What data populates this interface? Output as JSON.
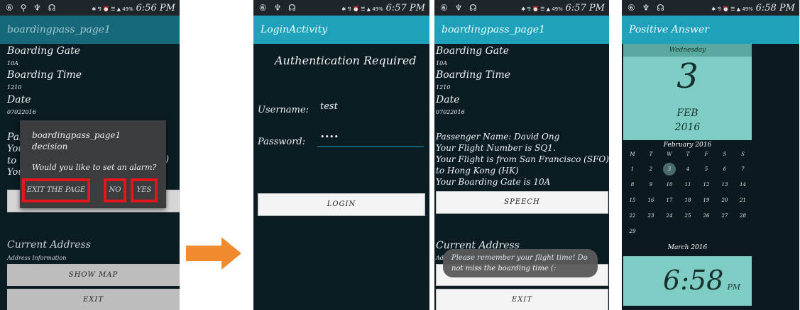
{
  "colors": {
    "action_bar": "#1fa1bc",
    "screen_bg": "#0b1c22",
    "highlight": "#e2161b",
    "arrow": "#f08a2e",
    "calendar_panel": "#7ecdc4"
  },
  "screen1": {
    "status_left": "⑥ ⚲ ♆ ☊",
    "status_right": "✱ ⅋ ⏰ ☰ ▲ 49%",
    "time": "6:56 PM",
    "title": "boardingpass_page1",
    "boarding_gate_label": "Boarding Gate",
    "boarding_gate_value": "10A",
    "boarding_time_label": "Boarding Time",
    "boarding_time_value": "1210",
    "date_label": "Date",
    "date_value": "07022016",
    "current_address_label": "Current Address",
    "address_information": "Address Information",
    "show_map_button": "SHOW MAP",
    "exit_button": "EXIT",
    "dialog": {
      "title_line1": "boardingpass_page1",
      "title_line2": "decision",
      "message": "Would you like to set an alarm?",
      "exit_the_page": "EXIT THE PAGE",
      "no": "NO",
      "yes": "YES"
    },
    "behind_dialog": {
      "pas": "Pas",
      "you1": "You",
      "to": "to",
      "you2": "You",
      "paren": ")"
    }
  },
  "screen2": {
    "status_left": "⑥ ♆ ☊",
    "status_right": "✱ ⅋ ⏰ ☰ ▲ 49%",
    "time": "6:57 PM",
    "title": "LoginActivity",
    "heading": "Authentication Required",
    "username_label": "Username:",
    "username_value": "test",
    "password_label": "Password:",
    "password_value": "••••",
    "login_button": "LOGIN"
  },
  "screen3": {
    "status_left": "⑥ ♆ ☊",
    "status_right": "✱ ⅋ ⏰ ☰ ▲ 49%",
    "time": "6:57 PM",
    "title": "boardingpass_page1",
    "boarding_gate_label": "Boarding Gate",
    "boarding_gate_value": "10A",
    "boarding_time_label": "Boarding Time",
    "boarding_time_value": "1210",
    "date_label": "Date",
    "date_value": "07022016",
    "passenger_lines": [
      "Passenger Name: David Ong",
      "Your Flight Number is SQ1.",
      "Your Flight is from San Francisco (SFO)",
      "to Hong Kong (HK)",
      " Your Boarding Gate is 10A"
    ],
    "speech_button": "SPEECH",
    "current_address_label": "Current Address",
    "address_short": "Ad",
    "toast_line1": "Please remember your flight time! Do",
    "toast_line2": "not miss the boarding time (:",
    "exit_button": "EXIT"
  },
  "screen4": {
    "status_left": "⑥ ♆ ☊",
    "status_right": "✱ ⅋ ⏰ ☰ ▲ 49%",
    "time": "6:58 PM",
    "title": "Positive Answer",
    "weekday": "Wednesday",
    "day_number": "3",
    "month": "FEB",
    "year": "2016",
    "month_title": "February 2016",
    "week_headers": [
      "M",
      "T",
      "W",
      "T",
      "F",
      "S",
      "S"
    ],
    "weeks": [
      [
        "1",
        "2",
        "3",
        "4",
        "5",
        "6",
        "7"
      ],
      [
        "8",
        "9",
        "10",
        "11",
        "12",
        "13",
        "14"
      ],
      [
        "15",
        "16",
        "17",
        "18",
        "19",
        "20",
        "21"
      ],
      [
        "22",
        "23",
        "24",
        "25",
        "26",
        "27",
        "28"
      ],
      [
        "29",
        "",
        "",
        "",
        "",
        "",
        ""
      ]
    ],
    "next_month_title": "March 2016",
    "clock_time": "6:58",
    "clock_ampm": "PM"
  }
}
